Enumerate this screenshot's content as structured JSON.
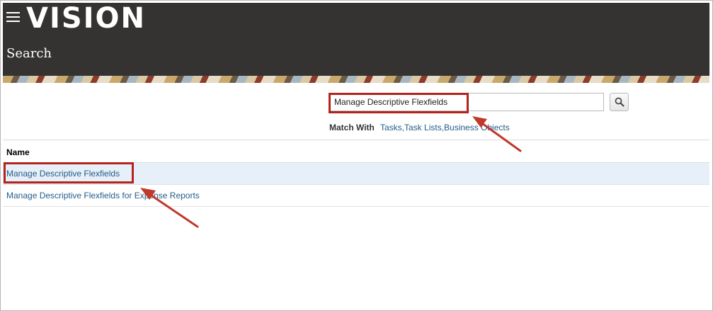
{
  "header": {
    "menu_icon": "hamburger-menu-icon",
    "logo": "VISION",
    "page_title": "Search"
  },
  "search": {
    "value": "Manage Descriptive Flexfields",
    "button_icon": "search-icon",
    "match_with_label": "Match With",
    "match_with_value": "Tasks,Task Lists,Business Objects"
  },
  "results": {
    "column_header": "Name",
    "rows": [
      {
        "label": "Manage Descriptive Flexfields",
        "selected": true
      },
      {
        "label": "Manage Descriptive Flexfields for Expense Reports",
        "selected": false
      }
    ]
  },
  "annotations": {
    "highlight_color": "#b3241c",
    "arrow_color": "#c0392b"
  },
  "colors": {
    "header_bg": "#353331",
    "link": "#245c8a",
    "selected_row_bg": "#e7eff8"
  }
}
